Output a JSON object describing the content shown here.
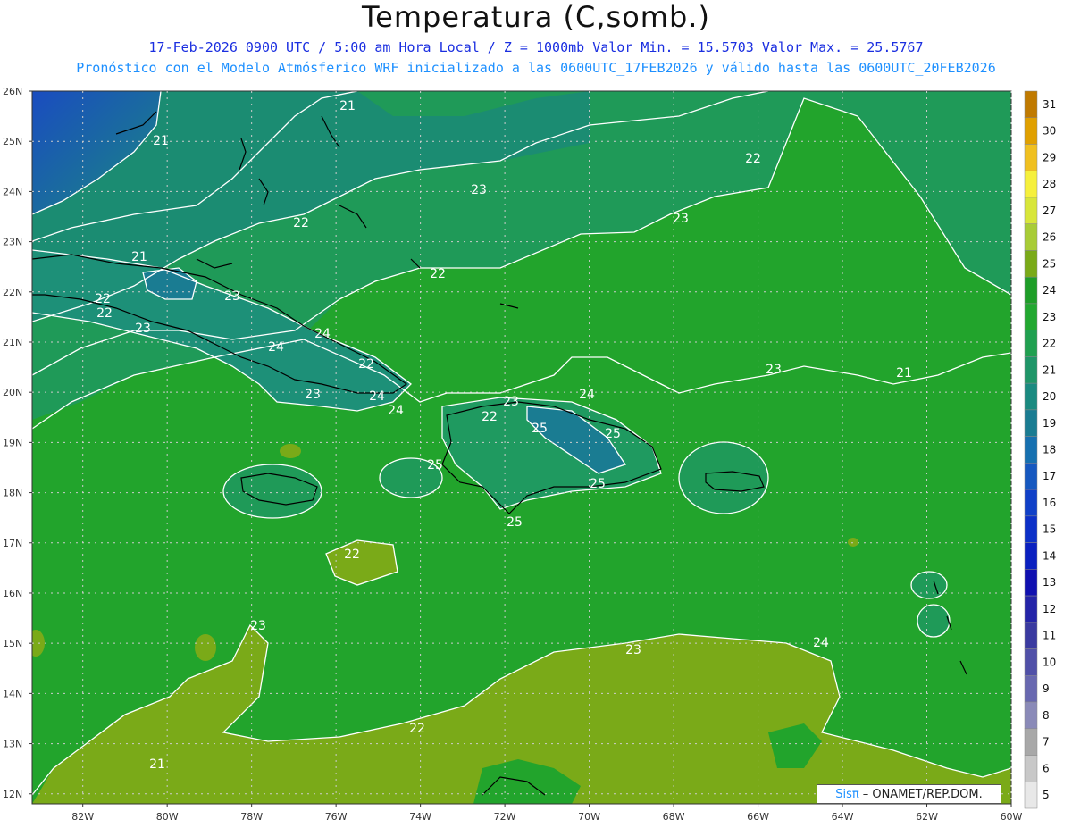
{
  "header": {
    "title": "Temperatura (C,somb.)",
    "line1": "17-Feb-2026  0900 UTC / 5:00 am Hora Local / Z = 1000mb   Valor Min. = 15.5703  Valor Max. = 25.5767",
    "line2": "Pronóstico con el Modelo Atmósferico WRF inicializado a las 0600UTC_17FEB2026 y válido hasta las  0600UTC_20FEB2026"
  },
  "axes": {
    "lat_labels": [
      "26N",
      "25N",
      "24N",
      "23N",
      "22N",
      "21N",
      "20N",
      "19N",
      "18N",
      "17N",
      "16N",
      "15N",
      "14N",
      "13N",
      "12N"
    ],
    "lon_labels": [
      "82W",
      "80W",
      "78W",
      "76W",
      "74W",
      "72W",
      "70W",
      "68W",
      "66W",
      "64W",
      "62W",
      "60W"
    ]
  },
  "colorbar": {
    "labels": [
      "31",
      "30",
      "29",
      "28",
      "27",
      "26",
      "25",
      "24",
      "23",
      "22",
      "21",
      "20",
      "19",
      "18",
      "17",
      "16",
      "15",
      "14",
      "13",
      "12",
      "11",
      "10",
      "9",
      "8",
      "7",
      "6",
      "5"
    ],
    "colors": [
      "#c07a00",
      "#e0a000",
      "#f0c020",
      "#f6f03c",
      "#d8e63a",
      "#a8cc36",
      "#7aaa18",
      "#1e9e28",
      "#22a830",
      "#20a050",
      "#1f9668",
      "#1a8a80",
      "#1a7c92",
      "#1670b0",
      "#1658c0",
      "#1040c8",
      "#0c30c8",
      "#0a20c0",
      "#1010b0",
      "#2424a8",
      "#3a3aa0",
      "#5050a8",
      "#6868b0",
      "#8a8ab8",
      "#a8a8a8",
      "#c8c8c8",
      "#e8e8e8"
    ]
  },
  "contour_labels": [
    "21",
    "21",
    "22",
    "21",
    "22",
    "22",
    "23",
    "23",
    "22",
    "23",
    "22",
    "23",
    "24",
    "24",
    "22",
    "23",
    "23",
    "21",
    "24",
    "24",
    "23",
    "22",
    "24",
    "25",
    "25",
    "25",
    "25",
    "25",
    "22",
    "23",
    "23",
    "24",
    "22",
    "21"
  ],
  "credit": {
    "logo": "Sisπ",
    "text": "– ONAMET/REP.DOM."
  },
  "palette": {
    "sea_warm": "#22a42c",
    "sea_cool": "#1f9a6a",
    "north_cold": "#1a55b8",
    "south_hot": "#7aaa18"
  }
}
